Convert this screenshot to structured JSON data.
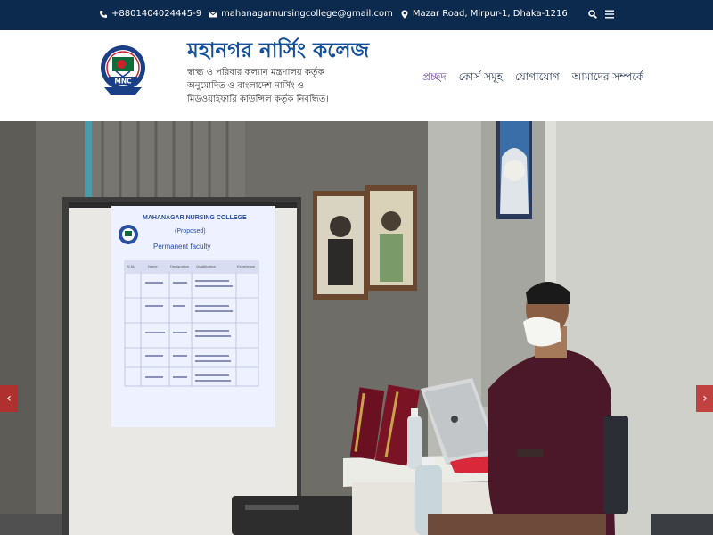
{
  "topbar": {
    "phone": "+8801404024445-9",
    "email": "mahanagarnursingcollege@gmail.com",
    "address": "Mazar Road, Mirpur-1, Dhaka-1216",
    "icons": [
      "phone-icon",
      "envelope-icon",
      "map-marker-icon",
      "search-icon",
      "menu-icon"
    ]
  },
  "header": {
    "logo_text": "MNC",
    "title": "মহানগর নার্সিং কলেজ",
    "subtitle": "স্বাস্থ্য ও পরিবার কল্যান মন্ত্রণালয় কর্তৃক অনুমোদিত ও বাংলাদেশ নার্সিং ও মিডওয়াইফারি কাউন্সিল কর্তৃক নিবন্ধিত।"
  },
  "nav": {
    "items": [
      {
        "label": "প্রচ্ছদ",
        "active": true
      },
      {
        "label": "কোর্স সমূহ",
        "active": false
      },
      {
        "label": "যোগাযোগ",
        "active": false
      },
      {
        "label": "আমাদের সম্পর্কে",
        "active": false
      }
    ]
  },
  "slider": {
    "prev": "‹",
    "next": "›",
    "slide": {
      "college": "MAHANAGAR NURSING COLLEGE",
      "proposed": "(Proposed)",
      "heading": "Permanent faculty",
      "columns": [
        "Sl No",
        "Name",
        "Designation",
        "Qualification",
        "Experience"
      ]
    }
  },
  "colors": {
    "topbar": "#0c2a4d",
    "title": "#14509a",
    "nav_active": "#6c3fa8",
    "arrow": "#be2828"
  }
}
